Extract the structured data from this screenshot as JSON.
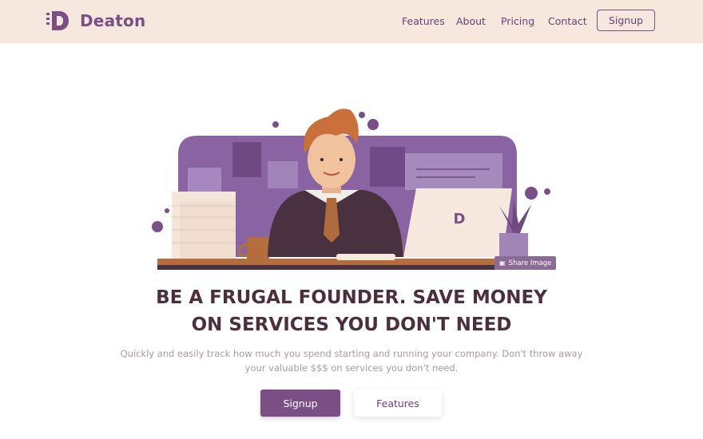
{
  "header": {
    "brand_name": "Deaton",
    "brand_letter": "D",
    "nav": [
      "Features",
      "About",
      "Pricing",
      "Contact"
    ],
    "signup_label": "Signup"
  },
  "hero": {
    "share_label": "Share Image",
    "headline_line1": "BE A FRUGAL FOUNDER. SAVE MONEY",
    "headline_line2": "ON SERVICES YOU DON'T NEED",
    "subtext": "Quickly and easily track how much you spend starting and running your company. Don't throw away your valuable $$$ on services you don't need.",
    "primary_cta": "Signup",
    "secondary_cta": "Features",
    "laptop_letter": "D"
  },
  "colors": {
    "brand": "#7a4f86",
    "header_bg": "#f7e8de",
    "headline": "#4b2f3f",
    "subtext": "#a79aa3"
  },
  "icons": [
    "brand-logo-icon",
    "image-icon"
  ]
}
